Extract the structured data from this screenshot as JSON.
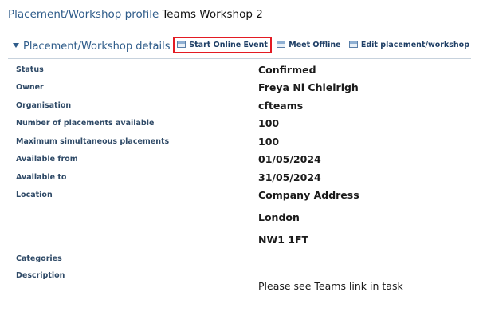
{
  "header": {
    "breadcrumb": "Placement/Workshop profile",
    "title": "Teams Workshop 2"
  },
  "section": {
    "title": "Placement/Workshop details",
    "actions": {
      "start_online": "Start Online Event",
      "meet_offline": "Meet Offline",
      "edit": "Edit placement/workshop"
    },
    "highlight_color": "#e31b23"
  },
  "details": {
    "status_label": "Status",
    "status_value": "Confirmed",
    "owner_label": "Owner",
    "owner_value": "Freya Ni Chleirigh",
    "organisation_label": "Organisation",
    "organisation_value": "cfteams",
    "num_placements_label": "Number of placements available",
    "num_placements_value": "100",
    "max_simultaneous_label": "Maximum simultaneous placements",
    "max_simultaneous_value": "100",
    "available_from_label": "Available from",
    "available_from_value": "01/05/2024",
    "available_to_label": "Available to",
    "available_to_value": "31/05/2024",
    "location_label": "Location",
    "location_line1": "Company Address",
    "location_line2": "London",
    "location_line3": "NW1 1FT",
    "categories_label": "Categories",
    "description_label": "Description",
    "description_value": "Please see Teams link in task"
  }
}
